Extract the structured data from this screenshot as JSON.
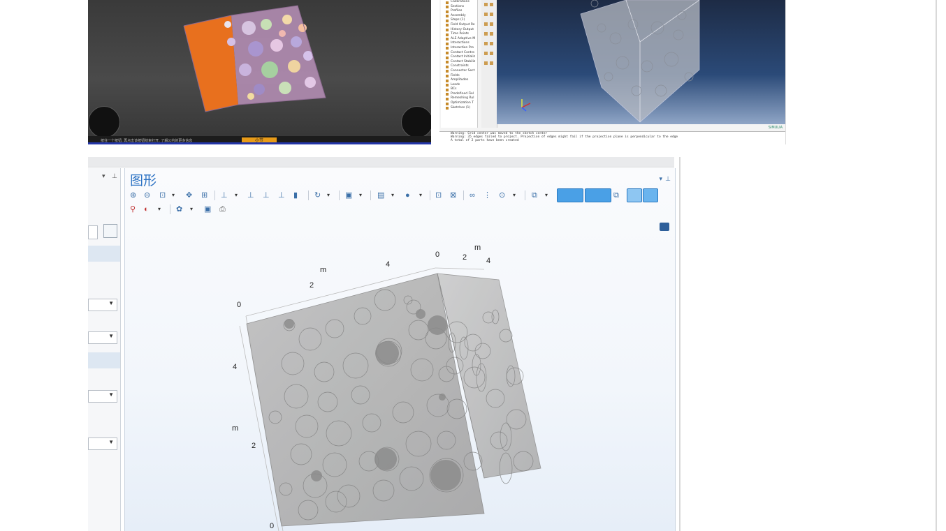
{
  "top_left_viewer": {
    "status_text": "按住一个按钮, 再点击该按钮结束打开, 了解公约的更多信息",
    "frame_tag": "小节"
  },
  "top_right_abaqus": {
    "tree_items": [
      "Calibrations",
      "Sections",
      "Profiles",
      "Assembly",
      "Steps (1)",
      "Field Output Re",
      "History Output",
      "Time Points",
      "ALE Adaptive M",
      "Interactions",
      "Interaction Pro",
      "Contact Contro",
      "Contact Initializ",
      "Contact Stabiliz",
      "Constraints",
      "Connector Sect",
      "Fields",
      "Amplitudes",
      "Loads",
      "BCs",
      "Predefined Fiel",
      "Remeshing Rul",
      "Optimization T",
      "Sketches (1)"
    ],
    "messages": [
      "Warning: Grid center was moved to the sketch center",
      "Warning: 35 edges failed to project. Projection of edges might fail if the projection plane is perpendicular to the edge",
      "A total of 2 parts have been created"
    ],
    "brand": "SIMULIA",
    "triad": {
      "x": "X",
      "y": "Y",
      "z": "Z"
    }
  },
  "comsol": {
    "graphics_title": "图形",
    "axis_labels": {
      "front_unit": "m",
      "front_ticks": [
        "0",
        "2",
        "4"
      ],
      "side_unit": "m",
      "side_ticks": [
        "0",
        "2",
        "4"
      ],
      "vertical_unit": "m",
      "vertical_ticks": [
        "0",
        "2",
        "4"
      ]
    }
  },
  "colors": {
    "accent": "#2d73c4",
    "orange_face": "#e8701e",
    "comsol_bg": "#eef3f9"
  }
}
